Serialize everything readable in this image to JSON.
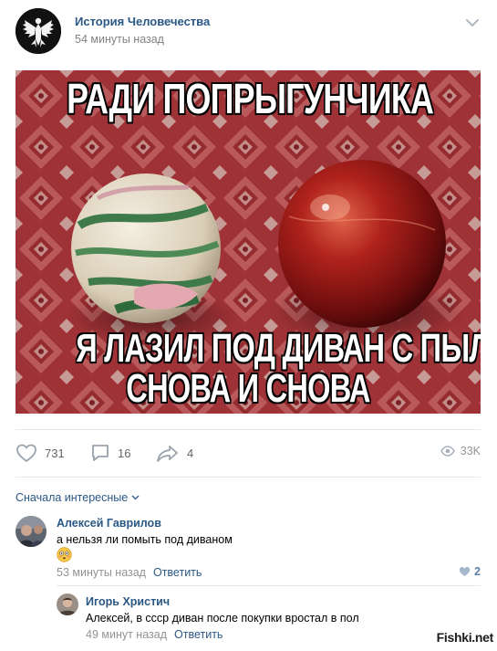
{
  "post": {
    "group_name": "История Человечества",
    "time": "54 минуты назад",
    "image": {
      "top_caption": "РАДИ ПОПРЫГУНЧИКА",
      "bottom_caption_line1": "Я ЛАЗИЛ ПОД ДИВАН С ПЫЛЬЮ",
      "bottom_caption_line2": "СНОВА И СНОВА"
    },
    "actions": {
      "likes": "731",
      "comments": "16",
      "shares": "4",
      "views": "33K"
    }
  },
  "comments_section": {
    "sort_label": "Сначала интересные",
    "comments": [
      {
        "author": "Алексей Гаврилов",
        "text": "а нельзя ли помыть под диваном",
        "time": "53 минуты назад",
        "reply_label": "Ответить",
        "likes": "2"
      }
    ],
    "replies": [
      {
        "author": "Игорь Христич",
        "text": "Алексей, в ссср диван после покупки вростал в пол",
        "time": "49 минут назад",
        "reply_label": "Ответить"
      }
    ]
  },
  "watermark": {
    "site": "Fishki.net"
  },
  "colors": {
    "link": "#2a5885",
    "meta": "#939393",
    "divider": "#e7e8ec",
    "icon": "#99a2ad"
  }
}
